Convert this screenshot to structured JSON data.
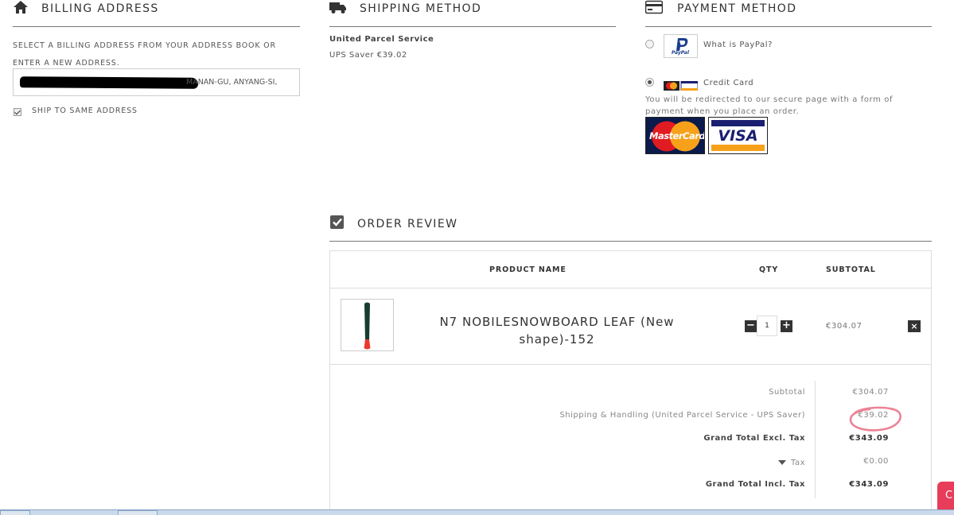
{
  "billing": {
    "title": "BILLING ADDRESS",
    "instructions": "SELECT A BILLING ADDRESS FROM YOUR ADDRESS BOOK OR ENTER A NEW ADDRESS.",
    "address_value": "MANAN-GU, ANYANG-SI,",
    "ship_same_label": "SHIP TO SAME ADDRESS",
    "ship_same_checked": true
  },
  "shipping": {
    "title": "SHIPPING METHOD",
    "carrier": "United Parcel Service",
    "option": "UPS Saver €39.02"
  },
  "payment": {
    "title": "PAYMENT METHOD",
    "paypal_link": "What is PayPal?",
    "paypal_logo": "PayPal",
    "credit_card_label": "Credit Card",
    "credit_card_selected": true,
    "redirect_note": "You will be redirected to our secure page with a form of payment when you place an order.",
    "mastercard_logo": "MasterCard",
    "visa_logo": "VISA"
  },
  "review": {
    "title": "ORDER REVIEW",
    "columns": {
      "product": "PRODUCT NAME",
      "qty": "QTY",
      "subtotal": "SUBTOTAL"
    },
    "item": {
      "name": "N7 NOBILESNOWBOARD LEAF (New shape)-152",
      "qty": "1",
      "subtotal": "€304.07",
      "minus": "−",
      "plus": "+",
      "remove": "×"
    },
    "totals": [
      {
        "label": "Subtotal",
        "value": "€304.07",
        "bold": false
      },
      {
        "label": "Shipping & Handling (United Parcel Service - UPS Saver)",
        "value": "€39.02",
        "bold": false
      },
      {
        "label": "Grand Total Excl. Tax",
        "value": "€343.09",
        "bold": true
      },
      {
        "label": "Tax",
        "value": "€0.00",
        "bold": false
      },
      {
        "label": "Grand Total Incl. Tax",
        "value": "€343.09",
        "bold": true
      }
    ]
  },
  "chat": {
    "label": "C"
  },
  "colors": {
    "accent_red": "#e73c5a",
    "dark": "#333333",
    "annotation": "#e8637a"
  }
}
